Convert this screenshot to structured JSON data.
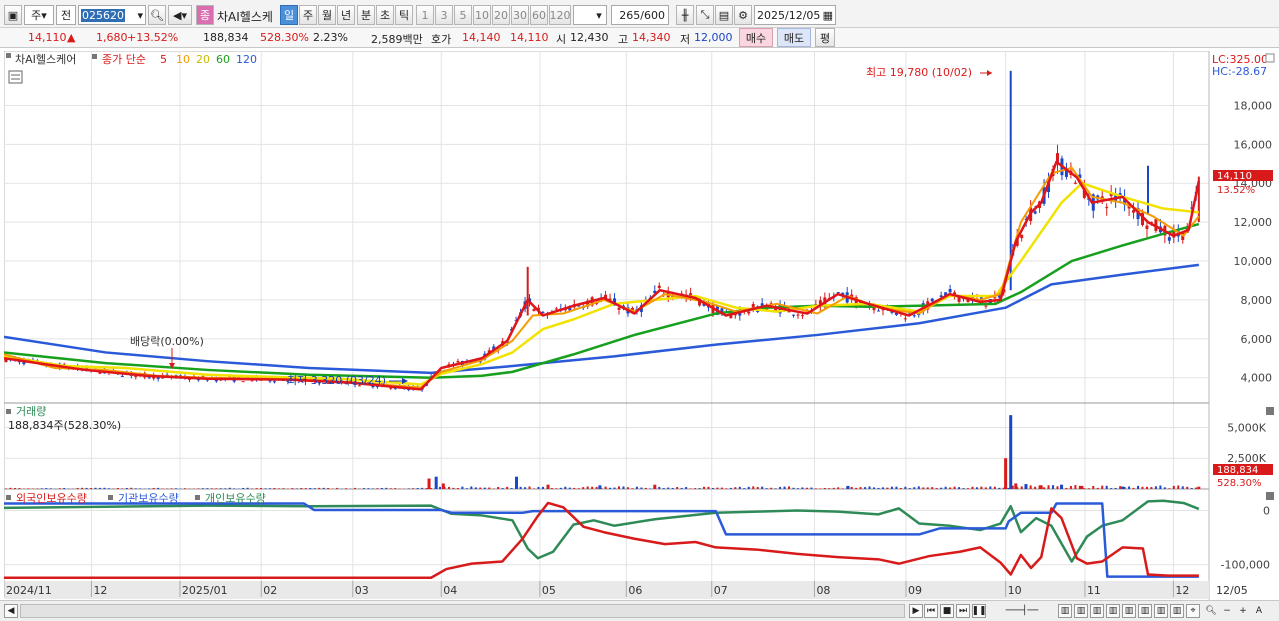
{
  "toolbar": {
    "market": "주",
    "period_sel": "전",
    "code": "025620",
    "sector_badge": "종",
    "stock_name": "차AI헬스케",
    "tab_day": "일",
    "tab_week": "주",
    "tab_month": "월",
    "tab_year": "년",
    "tab_minute": "분",
    "tab_second": "초",
    "tab_tick": "틱",
    "intervals": [
      "1",
      "3",
      "5",
      "10",
      "20",
      "30",
      "60",
      "120"
    ],
    "count": "265",
    "count_max": "/600",
    "date": "2025/12/05"
  },
  "infobar": {
    "price": "14,110",
    "change_arrow": "▲",
    "change": "1,680",
    "change_pct": "+13.52%",
    "volume": "188,834",
    "vol_ratio": "528.30%",
    "turnover": "2.23%",
    "amount": "2,589백만",
    "ask_label": "호가",
    "ask": "14,140",
    "bid": "14,110",
    "open_label": "시",
    "open": "12,430",
    "high_label": "고",
    "high": "14,340",
    "low_label": "저",
    "low": "12,000",
    "buy_label": "매수",
    "sell_label": "매도",
    "eval_label": "평"
  },
  "price_panel": {
    "name": "차AI헬스케어",
    "ma_label": "종가 단순",
    "ma_periods": [
      "5",
      "10",
      "20",
      "60",
      "120"
    ],
    "ma_colors": [
      "#e0151a",
      "#f59c00",
      "#f2e200",
      "#17a01e",
      "#2a5ad8"
    ],
    "lc": "LC:325.00",
    "hc": "HC:-28.67",
    "high_annot": "최고 19,780 (10/02)",
    "low_annot": "최저 3,320 (03/24)",
    "div_annot": "배당락(0.00%)",
    "price_tag": "14,110",
    "pct_tag": "13.52%"
  },
  "volume_panel": {
    "title": "거래량",
    "value": "188,834주(528.30%)",
    "tag": "188,834",
    "pct_tag": "528.30%"
  },
  "holding_panel": {
    "foreign": "외국인보유수량",
    "institution": "기관보유수량",
    "individual": "개인보유수량",
    "colors": [
      "#d81a1a",
      "#2a5ad8",
      "#2e8b57"
    ]
  },
  "chart_data": [
    {
      "type": "line",
      "name": "price",
      "yticks": [
        "18,000",
        "16,000",
        "14,000",
        "12,000",
        "10,000",
        "8,000",
        "6,000",
        "4,000"
      ],
      "ylim": [
        2700,
        20800
      ],
      "x": [
        "2024/11",
        "12",
        "2025/01",
        "02",
        "03",
        "04",
        "05",
        "06",
        "07",
        "08",
        "09",
        "10",
        "11",
        "12"
      ],
      "ma120": [
        [
          0,
          6100
        ],
        [
          100,
          5300
        ],
        [
          200,
          4850
        ],
        [
          300,
          4500
        ],
        [
          420,
          4250
        ],
        [
          500,
          4600
        ],
        [
          600,
          5100
        ],
        [
          700,
          5700
        ],
        [
          800,
          6200
        ],
        [
          900,
          6800
        ],
        [
          985,
          7600
        ],
        [
          1030,
          8800
        ],
        [
          1100,
          9300
        ],
        [
          1175,
          9800
        ]
      ],
      "ma60": [
        [
          0,
          5300
        ],
        [
          100,
          4750
        ],
        [
          200,
          4400
        ],
        [
          300,
          4150
        ],
        [
          420,
          4000
        ],
        [
          470,
          4100
        ],
        [
          500,
          4300
        ],
        [
          560,
          5200
        ],
        [
          620,
          6200
        ],
        [
          700,
          7300
        ],
        [
          750,
          7600
        ],
        [
          800,
          7700
        ],
        [
          850,
          7650
        ],
        [
          900,
          7700
        ],
        [
          975,
          7800
        ],
        [
          1000,
          8400
        ],
        [
          1050,
          10000
        ],
        [
          1100,
          10800
        ],
        [
          1140,
          11400
        ],
        [
          1175,
          11900
        ]
      ],
      "ma20": [
        [
          0,
          5100
        ],
        [
          60,
          4600
        ],
        [
          120,
          4500
        ],
        [
          200,
          4150
        ],
        [
          260,
          4050
        ],
        [
          330,
          3950
        ],
        [
          410,
          3650
        ],
        [
          430,
          4200
        ],
        [
          470,
          4700
        ],
        [
          500,
          5300
        ],
        [
          530,
          6500
        ],
        [
          560,
          7000
        ],
        [
          600,
          7800
        ],
        [
          640,
          8000
        ],
        [
          680,
          8200
        ],
        [
          720,
          7600
        ],
        [
          760,
          7400
        ],
        [
          800,
          7700
        ],
        [
          850,
          7800
        ],
        [
          900,
          7400
        ],
        [
          930,
          8200
        ],
        [
          975,
          8200
        ],
        [
          1000,
          10000
        ],
        [
          1040,
          13000
        ],
        [
          1060,
          14000
        ],
        [
          1100,
          13300
        ],
        [
          1140,
          12700
        ],
        [
          1175,
          12500
        ]
      ],
      "ma10": [
        [
          0,
          5200
        ],
        [
          50,
          4500
        ],
        [
          100,
          4400
        ],
        [
          150,
          4100
        ],
        [
          200,
          4000
        ],
        [
          260,
          3950
        ],
        [
          320,
          3850
        ],
        [
          410,
          3500
        ],
        [
          430,
          4300
        ],
        [
          470,
          4900
        ],
        [
          500,
          5900
        ],
        [
          520,
          7200
        ],
        [
          550,
          7300
        ],
        [
          590,
          8000
        ],
        [
          620,
          7400
        ],
        [
          650,
          8300
        ],
        [
          690,
          7900
        ],
        [
          720,
          7400
        ],
        [
          760,
          7800
        ],
        [
          800,
          7300
        ],
        [
          830,
          8200
        ],
        [
          860,
          7600
        ],
        [
          900,
          7300
        ],
        [
          930,
          8300
        ],
        [
          960,
          8000
        ],
        [
          980,
          8300
        ],
        [
          1000,
          12000
        ],
        [
          1030,
          14500
        ],
        [
          1050,
          14800
        ],
        [
          1070,
          13300
        ],
        [
          1100,
          13000
        ],
        [
          1130,
          12300
        ],
        [
          1160,
          11300
        ],
        [
          1175,
          12300
        ]
      ],
      "ma5": [
        [
          0,
          5000
        ],
        [
          40,
          4700
        ],
        [
          80,
          4400
        ],
        [
          140,
          4100
        ],
        [
          200,
          3950
        ],
        [
          280,
          3900
        ],
        [
          340,
          3750
        ],
        [
          410,
          3400
        ],
        [
          430,
          4500
        ],
        [
          470,
          5000
        ],
        [
          495,
          5900
        ],
        [
          515,
          8000
        ],
        [
          530,
          7200
        ],
        [
          560,
          7700
        ],
        [
          590,
          8100
        ],
        [
          620,
          7300
        ],
        [
          645,
          8500
        ],
        [
          680,
          8100
        ],
        [
          710,
          7200
        ],
        [
          750,
          7700
        ],
        [
          790,
          7300
        ],
        [
          820,
          8300
        ],
        [
          850,
          7800
        ],
        [
          890,
          7200
        ],
        [
          930,
          8300
        ],
        [
          960,
          7900
        ],
        [
          980,
          8000
        ],
        [
          995,
          11000
        ],
        [
          1010,
          12500
        ],
        [
          1020,
          13000
        ],
        [
          1035,
          15100
        ],
        [
          1055,
          14300
        ],
        [
          1070,
          13000
        ],
        [
          1100,
          13300
        ],
        [
          1125,
          12000
        ],
        [
          1150,
          11300
        ],
        [
          1165,
          11600
        ],
        [
          1175,
          14110
        ]
      ]
    },
    {
      "type": "bar",
      "name": "volume",
      "yticks": [
        "5,000K",
        "2,500K"
      ],
      "ylim": [
        0,
        6500
      ],
      "spikes": [
        [
          418,
          850
        ],
        [
          425,
          1000
        ],
        [
          432,
          450
        ],
        [
          504,
          1000
        ],
        [
          535,
          350
        ],
        [
          586,
          300
        ],
        [
          640,
          350
        ],
        [
          830,
          250
        ],
        [
          985,
          2500
        ],
        [
          990,
          6000
        ],
        [
          995,
          450
        ],
        [
          1005,
          400
        ],
        [
          1020,
          300
        ],
        [
          1040,
          350
        ],
        [
          1060,
          250
        ],
        [
          1100,
          200
        ],
        [
          1175,
          190
        ]
      ]
    },
    {
      "type": "line",
      "name": "holdings",
      "yticks": [
        "0",
        "-100,000"
      ],
      "ylim": [
        -130000,
        25000
      ],
      "foreign": [
        [
          0,
          -124000
        ],
        [
          420,
          -124000
        ],
        [
          435,
          -108000
        ],
        [
          460,
          -98000
        ],
        [
          490,
          -94000
        ],
        [
          510,
          -52000
        ],
        [
          525,
          -10000
        ],
        [
          535,
          14000
        ],
        [
          550,
          6000
        ],
        [
          570,
          -30000
        ],
        [
          590,
          -40000
        ],
        [
          620,
          -52000
        ],
        [
          650,
          -62000
        ],
        [
          680,
          -58000
        ],
        [
          700,
          -68000
        ],
        [
          740,
          -72000
        ],
        [
          780,
          -80000
        ],
        [
          820,
          -86000
        ],
        [
          860,
          -90000
        ],
        [
          880,
          -98000
        ],
        [
          910,
          -84000
        ],
        [
          940,
          -76000
        ],
        [
          960,
          -68000
        ],
        [
          980,
          -96000
        ],
        [
          990,
          -118000
        ],
        [
          1000,
          -82000
        ],
        [
          1010,
          -106000
        ],
        [
          1020,
          -86000
        ],
        [
          1030,
          4000
        ],
        [
          1040,
          -14000
        ],
        [
          1055,
          -88000
        ],
        [
          1065,
          -98000
        ],
        [
          1080,
          -94000
        ],
        [
          1100,
          -68000
        ],
        [
          1120,
          -70000
        ],
        [
          1125,
          -118000
        ],
        [
          1145,
          -120000
        ],
        [
          1175,
          -120000
        ]
      ],
      "institution": [
        [
          0,
          13000
        ],
        [
          295,
          13000
        ],
        [
          305,
          1000
        ],
        [
          430,
          1000
        ],
        [
          440,
          -4000
        ],
        [
          510,
          -4000
        ],
        [
          520,
          -1000
        ],
        [
          700,
          -1000
        ],
        [
          710,
          -44000
        ],
        [
          900,
          -44000
        ],
        [
          920,
          -33000
        ],
        [
          985,
          -33000
        ],
        [
          988,
          -20000
        ],
        [
          1000,
          -4000
        ],
        [
          1030,
          -4000
        ],
        [
          1035,
          13000
        ],
        [
          1080,
          13000
        ],
        [
          1085,
          -122000
        ],
        [
          1175,
          -122000
        ]
      ],
      "individual": [
        [
          0,
          5000
        ],
        [
          200,
          9000
        ],
        [
          300,
          8000
        ],
        [
          420,
          9000
        ],
        [
          440,
          -6000
        ],
        [
          470,
          -9000
        ],
        [
          500,
          -18000
        ],
        [
          515,
          -70000
        ],
        [
          525,
          -88000
        ],
        [
          540,
          -76000
        ],
        [
          560,
          -26000
        ],
        [
          580,
          -18000
        ],
        [
          600,
          -28000
        ],
        [
          640,
          -16000
        ],
        [
          670,
          -10000
        ],
        [
          700,
          -4000
        ],
        [
          740,
          -2000
        ],
        [
          780,
          0
        ],
        [
          820,
          -2000
        ],
        [
          860,
          -7000
        ],
        [
          880,
          4000
        ],
        [
          900,
          -24000
        ],
        [
          930,
          -28000
        ],
        [
          960,
          -36000
        ],
        [
          980,
          -24000
        ],
        [
          990,
          8000
        ],
        [
          1000,
          -40000
        ],
        [
          1015,
          -14000
        ],
        [
          1030,
          -28000
        ],
        [
          1050,
          -94000
        ],
        [
          1065,
          -48000
        ],
        [
          1080,
          -28000
        ],
        [
          1100,
          -18000
        ],
        [
          1125,
          17000
        ],
        [
          1140,
          18000
        ],
        [
          1160,
          14000
        ],
        [
          1175,
          3000
        ]
      ]
    }
  ]
}
